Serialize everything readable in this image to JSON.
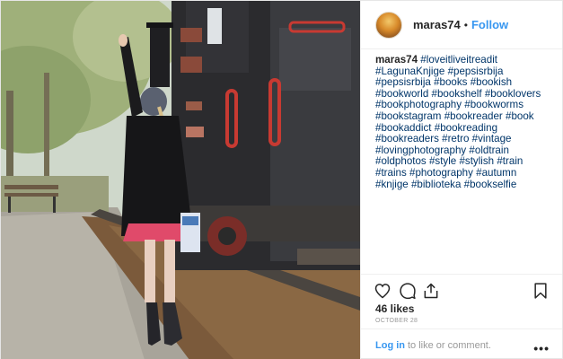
{
  "post": {
    "username": "maras74",
    "separator": "•",
    "follow_label": "Follow",
    "caption_user": "maras74",
    "caption_tags": "#loveitliveitreadit #LagunaKnjige #pepsisrbija #pepsisrbija #books #bookish #bookworld #bookshelf #booklovers #bookphotography #bookworms #bookstagram #bookreader #book #bookaddict #bookreading #bookreaders #retro #vintage #lovingphotography #oldtrain #oldphotos #style #stylish #train #trains #photography #autumn #knjige #biblioteka #bookselfie",
    "likes": "46 likes",
    "date": "OCTOBER 28",
    "login_label": "Log in",
    "comment_prompt": "to like or comment.",
    "more_label": "•••"
  },
  "icons": {
    "like": "heart-icon",
    "comment": "comment-icon",
    "share": "share-icon",
    "save": "bookmark-icon"
  },
  "colors": {
    "link": "#3897f0",
    "hashtag": "#003569",
    "text": "#262626",
    "muted": "#999999"
  }
}
